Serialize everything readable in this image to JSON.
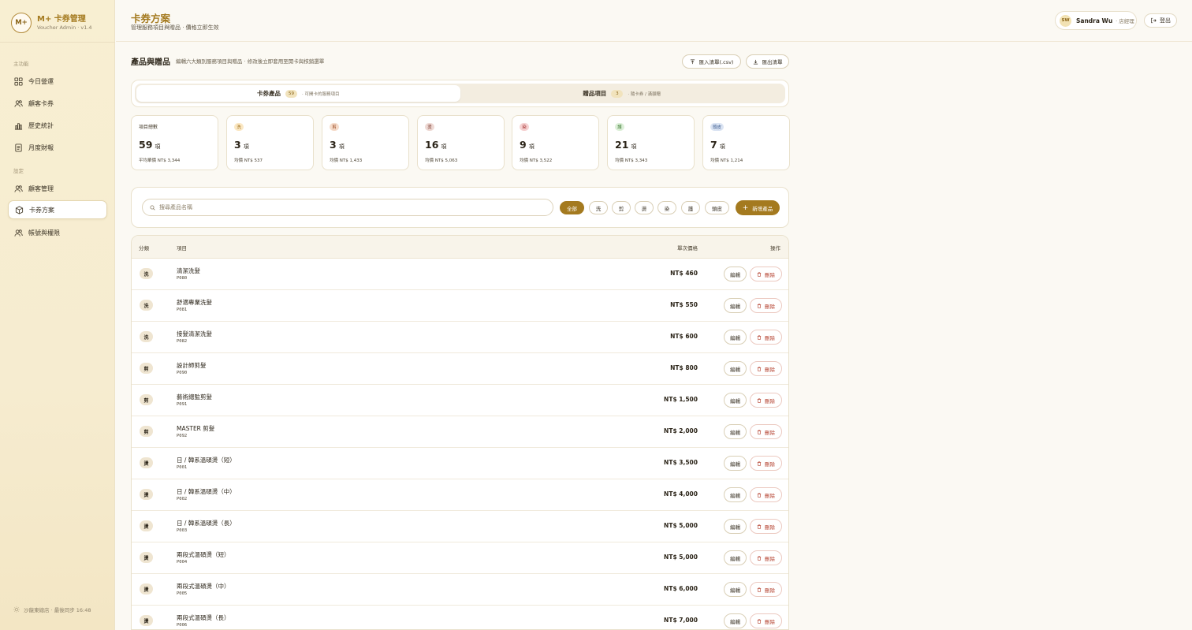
{
  "brand": {
    "logo": "M+",
    "name": "M+ 卡券管理",
    "sub": "Voucher Admin · v1.4"
  },
  "sidebar": {
    "section_main": "主功能",
    "section_settings": "設定",
    "items": [
      {
        "label": "今日營運",
        "icon": "grid-icon"
      },
      {
        "label": "顧客卡券",
        "icon": "users-icon"
      },
      {
        "label": "歷史統計",
        "icon": "chart-icon"
      },
      {
        "label": "月度財報",
        "icon": "document-icon"
      },
      {
        "label": "顧客管理",
        "icon": "users-icon"
      },
      {
        "label": "卡券方案",
        "icon": "box-icon",
        "active": true
      },
      {
        "label": "帳號與權限",
        "icon": "users-icon"
      }
    ],
    "footer": "沙龍東總店 · 最後同步 16:48"
  },
  "header": {
    "title": "卡券方案",
    "subtitle": "管理服務項目與贈品 · 價格立即生效",
    "user_initials": "SW",
    "user_name": "Sandra Wu",
    "user_role": "· 店經理",
    "logout": "登出"
  },
  "section": {
    "title": "產品與贈品",
    "desc": "編輯六大類別服務項目與贈品 · 修改後立即套用至開卡與核銷選單",
    "import_label": "匯入清單(.csv)",
    "export_label": "匯出清單"
  },
  "tabs": [
    {
      "label": "卡券產品",
      "count": "59",
      "hint": "· 可開卡的服務項目",
      "active": true
    },
    {
      "label": "贈品項目",
      "count": "3",
      "hint": "· 隨卡券 / 滿額贈",
      "active": false
    }
  ],
  "stats": {
    "total": {
      "label": "項目總數",
      "value": "59",
      "unit": "項",
      "avg": "平均單價 NT$ 3,344"
    },
    "categories": [
      {
        "badge": "洗",
        "value": "3",
        "unit": "項",
        "avg": "均價 NT$ 537",
        "bg": "#fbe8c4",
        "fg": "#9a6a14"
      },
      {
        "badge": "剪",
        "value": "3",
        "unit": "項",
        "avg": "均價 NT$ 1,433",
        "bg": "#f6dccb",
        "fg": "#9a4a22"
      },
      {
        "badge": "燙",
        "value": "16",
        "unit": "項",
        "avg": "均價 NT$ 5,063",
        "bg": "#eed9d4",
        "fg": "#7a3a2e"
      },
      {
        "badge": "染",
        "value": "9",
        "unit": "項",
        "avg": "均價 NT$ 3,522",
        "bg": "#f6d2d2",
        "fg": "#a12d2d"
      },
      {
        "badge": "護",
        "value": "21",
        "unit": "項",
        "avg": "均價 NT$ 3,343",
        "bg": "#dcefd8",
        "fg": "#3c7a32"
      },
      {
        "badge": "頭皮",
        "value": "7",
        "unit": "項",
        "avg": "均價 NT$ 1,214",
        "bg": "#dbe4f3",
        "fg": "#3a5a8e"
      }
    ]
  },
  "filter": {
    "search_placeholder": "搜尋產品名稱",
    "chips": [
      "全部",
      "洗",
      "剪",
      "燙",
      "染",
      "護",
      "頭皮"
    ],
    "active_chip": "全部",
    "add_label": "新增產品"
  },
  "table": {
    "headers": {
      "category": "分類",
      "item": "項目",
      "price": "單次價格",
      "actions": "操作"
    },
    "edit_label": "編輯",
    "delete_label": "刪除",
    "rows": [
      {
        "cat": "洗",
        "name": "清潔洗髮",
        "code": "P080",
        "price": "NT$ 460"
      },
      {
        "cat": "洗",
        "name": "舒適專業洗髮",
        "code": "P081",
        "price": "NT$ 550"
      },
      {
        "cat": "洗",
        "name": "接髮清潔洗髮",
        "code": "P082",
        "price": "NT$ 600"
      },
      {
        "cat": "剪",
        "name": "設計師剪髮",
        "code": "P090",
        "price": "NT$ 800"
      },
      {
        "cat": "剪",
        "name": "藝術總監剪髮",
        "code": "P091",
        "price": "NT$ 1,500"
      },
      {
        "cat": "剪",
        "name": "MASTER 剪髮",
        "code": "P092",
        "price": "NT$ 2,000"
      },
      {
        "cat": "燙",
        "name": "日 / 韓系溫碩燙（短）",
        "code": "P001",
        "price": "NT$ 3,500"
      },
      {
        "cat": "燙",
        "name": "日 / 韓系溫碩燙（中）",
        "code": "P002",
        "price": "NT$ 4,000"
      },
      {
        "cat": "燙",
        "name": "日 / 韓系溫碩燙（長）",
        "code": "P003",
        "price": "NT$ 5,000"
      },
      {
        "cat": "燙",
        "name": "兩段式溫碩燙（短）",
        "code": "P004",
        "price": "NT$ 5,000"
      },
      {
        "cat": "燙",
        "name": "兩段式溫碩燙（中）",
        "code": "P005",
        "price": "NT$ 6,000"
      },
      {
        "cat": "燙",
        "name": "兩段式溫碩燙（長）",
        "code": "P006",
        "price": "NT$ 7,000"
      }
    ]
  }
}
